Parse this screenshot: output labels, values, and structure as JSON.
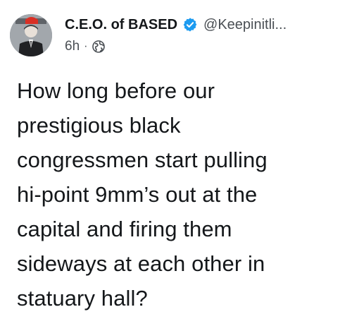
{
  "author": {
    "display_name": "C.E.O. of BASED",
    "handle": "@Keepinitli...",
    "verified_icon": "verified-badge-icon",
    "avatar_icon": "profile-photo"
  },
  "meta": {
    "time": "6h",
    "separator": "·",
    "audience_icon": "globe-icon"
  },
  "tweet": {
    "lines": [
      "How long before our",
      "prestigious black",
      "congressmen start pulling",
      "hi-point 9mm’s out at the",
      "capital and firing them",
      "sideways at each other in",
      "statuary hall?"
    ]
  },
  "colors": {
    "text": "#14171a",
    "secondary": "#4a4f54",
    "verified_blue": "#1d9bf0"
  }
}
